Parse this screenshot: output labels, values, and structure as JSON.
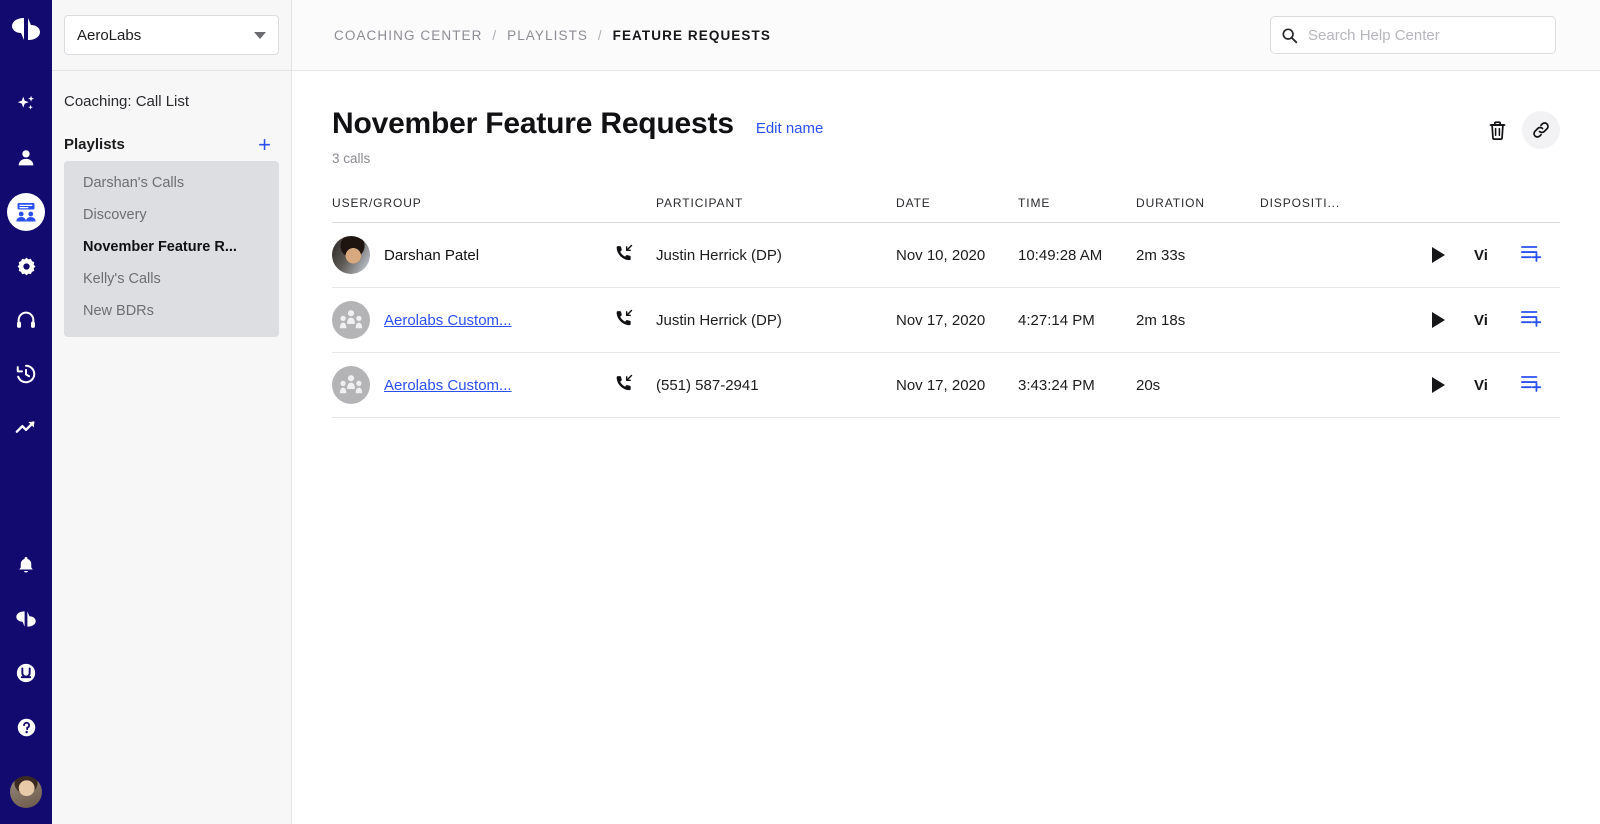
{
  "rail": {
    "logo_icon": "chat-bubbles-logo",
    "items": [
      {
        "icon": "sparkle-icon",
        "name": "rail-item-insights",
        "active": false
      },
      {
        "icon": "person-icon",
        "name": "rail-item-people",
        "active": false
      },
      {
        "icon": "coaching-group-icon",
        "name": "rail-item-coaching",
        "active": true
      },
      {
        "icon": "gear-icon",
        "name": "rail-item-settings",
        "active": false
      },
      {
        "icon": "headset-icon",
        "name": "rail-item-calls",
        "active": false
      },
      {
        "icon": "history-clock-icon",
        "name": "rail-item-history",
        "active": false
      },
      {
        "icon": "trending-up-icon",
        "name": "rail-item-analytics",
        "active": false
      }
    ],
    "bottom_items": [
      {
        "icon": "bell-icon",
        "name": "rail-item-notifications"
      },
      {
        "icon": "chat-bubbles-icon",
        "name": "rail-item-messages"
      },
      {
        "icon": "smiley-u-icon",
        "name": "rail-item-feedback"
      },
      {
        "icon": "question-mark-icon",
        "name": "rail-item-help"
      }
    ],
    "avatar_name": "user-avatar"
  },
  "sidebar": {
    "workspace": "AeroLabs",
    "section_title": "Coaching: Call List",
    "playlists_label": "Playlists",
    "add_symbol": "+",
    "playlists": [
      {
        "label": "Darshan's Calls",
        "selected": false
      },
      {
        "label": "Discovery",
        "selected": false
      },
      {
        "label": "November Feature R...",
        "selected": true
      },
      {
        "label": "Kelly's Calls",
        "selected": false
      },
      {
        "label": "New BDRs",
        "selected": false
      }
    ]
  },
  "topbar": {
    "breadcrumb": {
      "first": "COACHING CENTER",
      "second": "PLAYLISTS",
      "current": "FEATURE REQUESTS",
      "separator": "/"
    },
    "search_placeholder": "Search Help Center",
    "search_value": "",
    "search_icon": "search-icon"
  },
  "page": {
    "title": "November Feature Requests",
    "edit_name": "Edit name",
    "call_count": "3 calls",
    "delete_icon": "trash-icon",
    "share_icon": "link-icon"
  },
  "table": {
    "columns": [
      "USER/GROUP",
      "PARTICIPANT",
      "DATE",
      "TIME",
      "DURATION",
      "DISPOSITI..."
    ],
    "rows": [
      {
        "avatar_type": "photo",
        "user": "Darshan Patel",
        "user_is_link": false,
        "direction_icon": "incoming-call-icon",
        "participant": "Justin Herrick (DP)",
        "date": "Nov 10, 2020",
        "time": "10:49:28 AM",
        "duration": "2m 33s",
        "disposition": "",
        "play_label": "play-icon",
        "view_label": "Vi",
        "add_icon": "add-to-playlist-icon"
      },
      {
        "avatar_type": "group",
        "user": "Aerolabs Custom...",
        "user_is_link": true,
        "direction_icon": "incoming-call-icon",
        "participant": "Justin Herrick (DP)",
        "date": "Nov 17, 2020",
        "time": "4:27:14 PM",
        "duration": "2m 18s",
        "disposition": "",
        "play_label": "play-icon",
        "view_label": "Vi",
        "add_icon": "add-to-playlist-icon"
      },
      {
        "avatar_type": "group",
        "user": "Aerolabs Custom...",
        "user_is_link": true,
        "direction_icon": "incoming-call-icon",
        "participant": "(551) 587-2941",
        "date": "Nov 17, 2020",
        "time": "3:43:24 PM",
        "duration": "20s",
        "disposition": "",
        "play_label": "play-icon",
        "view_label": "Vi",
        "add_icon": "add-to-playlist-icon"
      }
    ]
  },
  "colors": {
    "rail_bg": "#120a6e",
    "accent_blue": "#2b50f0",
    "panel_bg": "#f7f7f8",
    "playlist_box": "#dddee1"
  }
}
